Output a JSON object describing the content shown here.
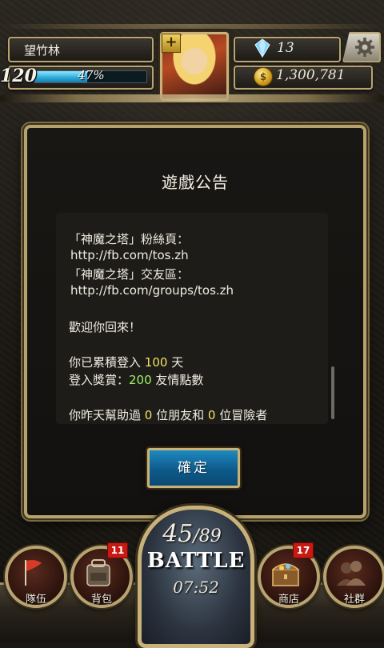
{
  "header": {
    "player_name": "望竹林",
    "level": "120",
    "exp_percent_text": "47%",
    "exp_fraction": 0.47,
    "diamonds": "13",
    "coins": "1,300,781"
  },
  "dialog": {
    "title": "遊戲公告",
    "lines": [
      "「神魔之塔」粉絲頁：",
      "http://fb.com/tos.zh",
      "「神魔之塔」交友區：",
      "http://fb.com/groups/tos.zh",
      "歡迎你回來！"
    ],
    "login": {
      "prefix": "你已累積登入 ",
      "days": "100",
      "suffix": " 天"
    },
    "reward": {
      "prefix": "登入獎賞：",
      "amount": "200",
      "suffix": " 友情點數"
    },
    "help": {
      "prefix": "你昨天幫助過 ",
      "friends": "0",
      "middle": " 位朋友和 ",
      "adventurers": "0",
      "suffix": " 位冒險者"
    },
    "confirm_label": "確定"
  },
  "nav": {
    "team_label": "隊伍",
    "backpack_label": "背包",
    "backpack_badge": "11",
    "battle_stamina_current": "45",
    "battle_stamina_max": "/89",
    "battle_label": "BATTLE",
    "battle_timer": "07:52",
    "shop_label": "商店",
    "shop_badge": "17",
    "social_label": "社群"
  },
  "colors": {
    "gold_frame": "#b8a472",
    "confirm_blue": "#1e8ac0",
    "highlight_yellow": "#f2e060",
    "highlight_green": "#9cf26a",
    "badge_red": "#c81a12"
  }
}
